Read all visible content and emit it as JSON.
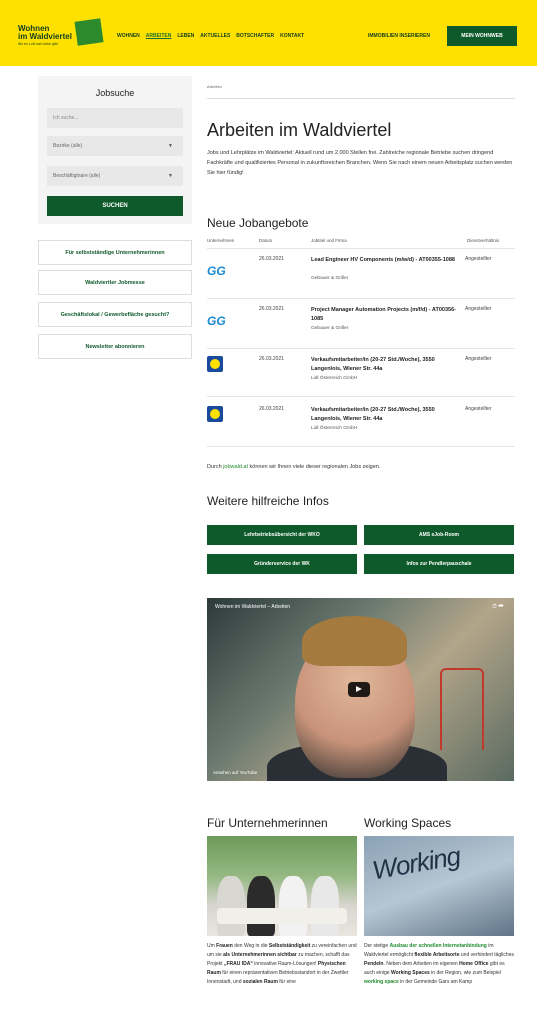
{
  "header": {
    "logo_line1": "Wohnen",
    "logo_line2": "im Waldviertel",
    "logo_tagline": "Wo es Luft und Liebe gibt",
    "nav": [
      "WOHNEN",
      "ARBEITEN",
      "LEBEN",
      "AKTUELLES",
      "BOTSCHAFTER",
      "KONTAKT"
    ],
    "active_nav": "ARBEITEN",
    "immobilien": "IMMOBILIEN INSERIEREN",
    "mein": "MEIN WOHNWEB",
    "colors": {
      "bar": "#ffe100",
      "dark_green": "#0f5a2a"
    }
  },
  "sidebar": {
    "title": "Jobsuche",
    "search_placeholder": "Ich suche...",
    "district": "Bezirke (alle)",
    "hours": "Beschäftigtnare (alle)",
    "search_button": "SUCHEN",
    "links": [
      "Für selbstständige Unternehmerinnen",
      "Waldviertler Jobmesse",
      "Geschäftslokal / Gewerbefläche gesucht?",
      "Newsletter abonnieren"
    ]
  },
  "main": {
    "breadcrumb": "Arbeiten",
    "title": "Arbeiten im Waldviertel",
    "intro": "Jobs und Lehrplätze im Waldviertel: Aktuell rund um 2.000 Stellen frei. Zahlreiche regionale Betriebe suchen dringend Fachkräfte und qualifiziertes Personal in zukunftsreichen Branchen. Wenn Sie nach einem neuen Arbeitsplatz suchen werden Sie hier fündig!",
    "jobs_heading": "Neue Jobangebote",
    "table_headers": [
      "Unternehmen",
      "Datum",
      "Jobtitel und Firma",
      "Dienstverhältnis"
    ],
    "jobs": [
      {
        "logo": "GG",
        "date": "26.03.2021",
        "title": "Lead Engineer HV Components (m/w/d) - AT00355-1088",
        "company": "Gebauer & Griller",
        "type": "Angestellter"
      },
      {
        "logo": "GG",
        "date": "26.03.2021",
        "title": "Project Manager Automation Projects (m/f/d) - AT00356-1085",
        "company": "Gebauer & Griller",
        "type": "Angestellter"
      },
      {
        "logo": "LIDL",
        "date": "26.03.2021",
        "title": "Verkaufsmitarbeiter/in (20-27 Std./Woche), 3550 Langenlois, Wiener Str. 44a",
        "company": "Lidl Österreich GmbH",
        "type": "Angestellter"
      },
      {
        "logo": "LIDL",
        "date": "26.03.2021",
        "title": "Verkaufsmitarbeiter/in (20-27 Std./Woche), 3550 Langenlois, Wiener Str. 44a",
        "company": "Lidl Österreich GmbH",
        "type": "Angestellter"
      }
    ],
    "more_text_pre": "Durch ",
    "more_link": "jobwald.at",
    "more_text_post": " können wir Ihnen viele dieser regionalen Jobs zeigen.",
    "info_heading": "Weitere hilfreiche Infos",
    "info_buttons": [
      "Lehrbetriebsübersicht der WKO",
      "AMS eJob-Room",
      "Gründerservice der WK",
      "Infos zur Pendlerpauschale"
    ],
    "video_title": "Wohnen im Waldviertel – Arbeiten",
    "video_watch": "Ansehen auf YouTube",
    "col1_heading": "Für Unternehmerinnen",
    "col2_heading": "Working Spaces",
    "col1_text_1": "Um ",
    "col1_text_2": "Frauen",
    "col1_text_3": " den Weg in die ",
    "col1_text_4": "Selbstständigkeit",
    "col1_text_5": " zu vereinfachen und um sie ",
    "col1_text_6": "als Unternehmerinnen sichtbar",
    "col1_text_7": " zu machen, schafft das Projekt ",
    "col1_text_8": "„FRAU IDA“",
    "col1_text_9": " innovative Raum-Lösungen! ",
    "col1_text_10": "Physischen Raum",
    "col1_text_11": " für einen repräsentativen Betriebsstandort in der Zwettler Innenstadt, und ",
    "col1_text_12": "sozialen Raum",
    "col1_text_13": " für eine",
    "col2_text_1": "Der stetige ",
    "col2_text_2": "Ausbau der schnellen Internetanbindung",
    "col2_text_3": " im Waldviertel ermöglicht ",
    "col2_text_4": "flexible Arbeitsorte",
    "col2_text_5": " und verhindert tägliches ",
    "col2_text_6": "Pendeln",
    "col2_text_7": ". Neben dem Arbeiten im eigenen ",
    "col2_text_8": "Home Office",
    "col2_text_9": " gibt es auch einige ",
    "col2_text_10": "Working Spaces",
    "col2_text_11": " in der Region, wie zum Beispiel ",
    "col2_text_12": "working space",
    "col2_text_13": " in der Gemeinde Gars am Kamp"
  }
}
